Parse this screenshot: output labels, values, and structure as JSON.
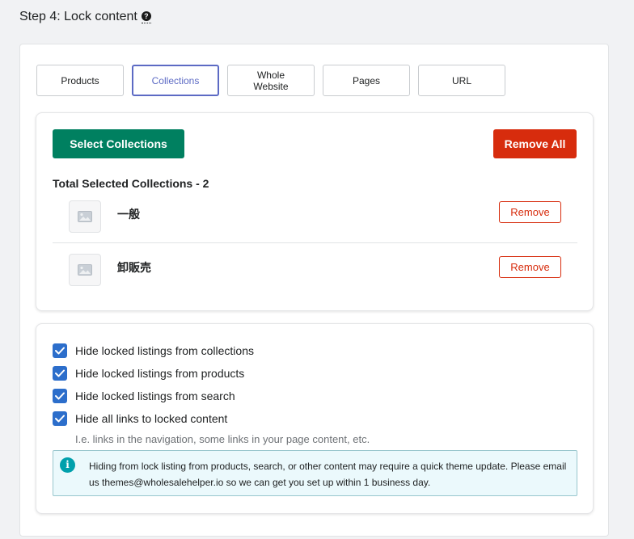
{
  "step": {
    "title": "Step 4: Lock content",
    "help_glyph": "?"
  },
  "tabs": [
    {
      "label": "Products",
      "active": false
    },
    {
      "label": "Collections",
      "active": true
    },
    {
      "label": "Whole Website",
      "active": false
    },
    {
      "label": "Pages",
      "active": false
    },
    {
      "label": "URL",
      "active": false
    }
  ],
  "collections_card": {
    "select_label": "Select Collections",
    "remove_all_label": "Remove All",
    "total_label": "Total Selected Collections - 2",
    "items": [
      {
        "name": "一般",
        "remove_label": "Remove"
      },
      {
        "name": "卸販売",
        "remove_label": "Remove"
      }
    ]
  },
  "options": {
    "items": [
      {
        "label": "Hide locked listings from collections",
        "checked": true
      },
      {
        "label": "Hide locked listings from products",
        "checked": true
      },
      {
        "label": "Hide locked listings from search",
        "checked": true
      },
      {
        "label": "Hide all links to locked content",
        "checked": true
      }
    ],
    "hint": "I.e. links in the navigation, some links in your page content, etc.",
    "info_glyph": "i",
    "info_text": "Hiding from lock listing from products, search, or other content may require a quick theme update. Please email us themes@wholesalehelper.io so we can get you set up within 1 business day."
  },
  "colors": {
    "primary_green": "#008060",
    "critical_red": "#d72c0d",
    "tab_active": "#5c6ac4",
    "checkbox_blue": "#2c6ecb",
    "info_teal": "#00a0ac"
  },
  "icons": {
    "help": "question-circle-icon",
    "thumbnail": "image-placeholder-icon",
    "check": "checkmark-icon",
    "info": "info-circle-icon"
  }
}
